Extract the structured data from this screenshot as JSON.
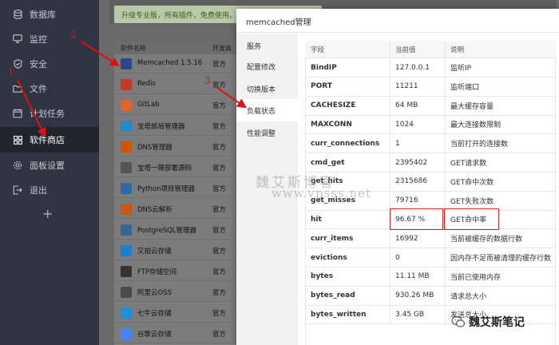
{
  "sidebar": {
    "items": [
      {
        "label": "数据库",
        "icon": "database-icon"
      },
      {
        "label": "监控",
        "icon": "monitor-icon"
      },
      {
        "label": "安全",
        "icon": "shield-icon"
      },
      {
        "label": "文件",
        "icon": "folder-icon"
      },
      {
        "label": "计划任务",
        "icon": "clock-icon"
      },
      {
        "label": "软件商店",
        "icon": "grid-icon",
        "active": true
      },
      {
        "label": "面板设置",
        "icon": "gear-icon"
      },
      {
        "label": "退出",
        "icon": "logout-icon"
      }
    ],
    "add_label": "+"
  },
  "background": {
    "promo": "升级专业版，所有插件，免费使用。",
    "col_name": "软件名称",
    "col_dev": "开发商",
    "apps": [
      {
        "name": "Memcached 1.5.16",
        "dev": "官方",
        "icon": "memcached-icon",
        "color": "#2a4a8a"
      },
      {
        "name": "Redis",
        "dev": "官方",
        "icon": "redis-icon",
        "color": "#c0392b"
      },
      {
        "name": "GitLab",
        "dev": "官方",
        "icon": "gitlab-icon",
        "color": "#e2632d"
      },
      {
        "name": "宝塔邮局管理器",
        "dev": "官方",
        "icon": "mail-icon",
        "color": "#2e86c1"
      },
      {
        "name": "DNS管理器",
        "dev": "官方",
        "icon": "dns-icon",
        "color": "#d35400"
      },
      {
        "name": "宝塔一键部署源码",
        "dev": "官方",
        "icon": "code-icon",
        "color": "#555555"
      },
      {
        "name": "Python项目管理器",
        "dev": "官方",
        "icon": "python-icon",
        "color": "#2f6aa6"
      },
      {
        "name": "DNS云解析",
        "dev": "官方",
        "icon": "dns-cloud-icon",
        "color": "#c45a16"
      },
      {
        "name": "PostgreSQL管理器",
        "dev": "官方",
        "icon": "postgresql-icon",
        "color": "#336791"
      },
      {
        "name": "又拍云存储",
        "dev": "官方",
        "icon": "upyun-icon",
        "color": "#1a7fd0"
      },
      {
        "name": "FTP存储空间",
        "dev": "官方",
        "icon": "ftp-icon",
        "color": "#333333"
      },
      {
        "name": "阿里云OSS",
        "dev": "官方",
        "icon": "aliyun-icon",
        "color": "#4a4a4a"
      },
      {
        "name": "七牛云存储",
        "dev": "官方",
        "icon": "qiniu-icon",
        "color": "#1e90d6"
      },
      {
        "name": "谷歌云存储",
        "dev": "官方",
        "icon": "google-cloud-icon",
        "color": "#4285f4"
      }
    ]
  },
  "modal": {
    "title": "memcached管理",
    "nav": [
      {
        "label": "服务"
      },
      {
        "label": "配置修改"
      },
      {
        "label": "切换版本"
      },
      {
        "label": "负载状态",
        "active": true
      },
      {
        "label": "性能调整"
      }
    ],
    "table": {
      "headers": [
        "字段",
        "当前值",
        "说明"
      ],
      "rows": [
        {
          "field": "BindIP",
          "value": "127.0.0.1",
          "desc": "监听IP"
        },
        {
          "field": "PORT",
          "value": "11211",
          "desc": "监听端口"
        },
        {
          "field": "CACHESIZE",
          "value": "64 MB",
          "desc": "最大缓存容量"
        },
        {
          "field": "MAXCONN",
          "value": "1024",
          "desc": "最大连接数限制"
        },
        {
          "field": "curr_connections",
          "value": "1",
          "desc": "当前打开的连接数"
        },
        {
          "field": "cmd_get",
          "value": "2395402",
          "desc": "GET请求数"
        },
        {
          "field": "get_hits",
          "value": "2315686",
          "desc": "GET命中次数"
        },
        {
          "field": "get_misses",
          "value": "79716",
          "desc": "GET失败次数"
        },
        {
          "field": "hit",
          "value": "96.67 %",
          "desc": "GET命中率"
        },
        {
          "field": "curr_items",
          "value": "16992",
          "desc": "当前被缓存的数据行数"
        },
        {
          "field": "evictions",
          "value": "0",
          "desc": "因内存不足而被清理的缓存行数"
        },
        {
          "field": "bytes",
          "value": "11.11 MB",
          "desc": "当前已使用内存"
        },
        {
          "field": "bytes_read",
          "value": "930.26 MB",
          "desc": "请求总大小"
        },
        {
          "field": "bytes_written",
          "value": "3.45 GB",
          "desc": "发送总大小"
        }
      ]
    }
  },
  "annotations": {
    "step1": "1",
    "step2": "2",
    "step3": "3",
    "watermark_cn": "魏艾斯博客",
    "watermark_url": "www.vpsss.net",
    "brand": "魏艾斯笔记"
  },
  "colors": {
    "sidebar_bg": "#2f3542",
    "accent_red": "#e02020"
  }
}
